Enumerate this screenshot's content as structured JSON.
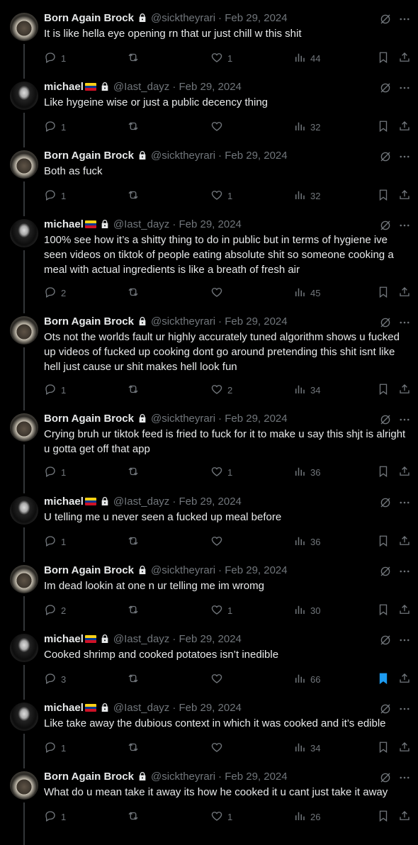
{
  "colors": {
    "background": "#000000",
    "text": "#e7e9ea",
    "muted": "#71767b",
    "accent": "#1d9bf0",
    "thread_line": "#333639"
  },
  "tweets": [
    {
      "name": "Born Again Brock",
      "handle": "@sicktheyrari",
      "date": "· Feb 29, 2024",
      "text": "It is like hella eye opening rn that ur just chill w this shit",
      "replies": "1",
      "retweets": "",
      "likes": "1",
      "views": "44",
      "avatar": "brock",
      "flag": false,
      "bookmarked": false
    },
    {
      "name": "michael",
      "handle": "@Iast_dayz",
      "date": "· Feb 29, 2024",
      "text": "Like hygeine wise or just a public decency thing",
      "replies": "1",
      "retweets": "",
      "likes": "",
      "views": "32",
      "avatar": "michael",
      "flag": true,
      "bookmarked": false
    },
    {
      "name": "Born Again Brock",
      "handle": "@sicktheyrari",
      "date": "· Feb 29, 2024",
      "text": "Both as fuck",
      "replies": "1",
      "retweets": "",
      "likes": "1",
      "views": "32",
      "avatar": "brock",
      "flag": false,
      "bookmarked": false
    },
    {
      "name": "michael",
      "handle": "@Iast_dayz",
      "date": "· Feb 29, 2024",
      "text": "100% see how it’s a shitty thing to do in public but in terms of hygiene ive seen videos on tiktok of people eating absolute shit so someone cooking a meal with actual ingredients is like a breath of fresh air",
      "replies": "2",
      "retweets": "",
      "likes": "",
      "views": "45",
      "avatar": "michael",
      "flag": true,
      "bookmarked": false
    },
    {
      "name": "Born Again Brock",
      "handle": "@sicktheyrari",
      "date": "· Feb 29, 2024",
      "text": "Ots not the worlds fault ur highly accurately tuned algorithm shows u fucked up videos of fucked up cooking dont go around pretending this shit isnt like hell just cause ur shit makes hell look fun",
      "replies": "1",
      "retweets": "",
      "likes": "2",
      "views": "34",
      "avatar": "brock",
      "flag": false,
      "bookmarked": false
    },
    {
      "name": "Born Again Brock",
      "handle": "@sicktheyrari",
      "date": "· Feb 29, 2024",
      "text": "Crying bruh ur tiktok feed is fried to fuck for it to make u say this shjt is alright u gotta get off that app",
      "replies": "1",
      "retweets": "",
      "likes": "1",
      "views": "36",
      "avatar": "brock",
      "flag": false,
      "bookmarked": false
    },
    {
      "name": "michael",
      "handle": "@Iast_dayz",
      "date": "· Feb 29, 2024",
      "text": "U telling me u never seen a fucked up meal before",
      "replies": "1",
      "retweets": "",
      "likes": "",
      "views": "36",
      "avatar": "michael",
      "flag": true,
      "bookmarked": false
    },
    {
      "name": "Born Again Brock",
      "handle": "@sicktheyrari",
      "date": "· Feb 29, 2024",
      "text": "Im dead lookin at one n ur telling me im wromg",
      "replies": "2",
      "retweets": "",
      "likes": "1",
      "views": "30",
      "avatar": "brock",
      "flag": false,
      "bookmarked": false
    },
    {
      "name": "michael",
      "handle": "@Iast_dayz",
      "date": "· Feb 29, 2024",
      "text": "Cooked shrimp and cooked potatoes isn’t inedible",
      "replies": "3",
      "retweets": "",
      "likes": "",
      "views": "66",
      "avatar": "michael",
      "flag": true,
      "bookmarked": true
    },
    {
      "name": "michael",
      "handle": "@Iast_dayz",
      "date": "· Feb 29, 2024",
      "text": "Like take away the dubious context in which it was cooked and it’s edible",
      "replies": "1",
      "retweets": "",
      "likes": "",
      "views": "34",
      "avatar": "michael",
      "flag": true,
      "bookmarked": false
    },
    {
      "name": "Born Again Brock",
      "handle": "@sicktheyrari",
      "date": "· Feb 29, 2024",
      "text": "What do u mean take it away its how he cooked it u cant just take it away",
      "replies": "1",
      "retweets": "",
      "likes": "1",
      "views": "26",
      "avatar": "brock",
      "flag": false,
      "bookmarked": false
    }
  ]
}
